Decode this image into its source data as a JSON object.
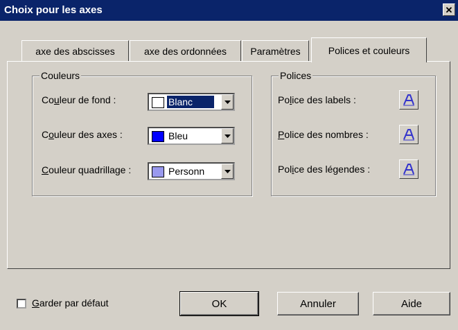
{
  "window": {
    "title": "Choix pour les axes",
    "close_label": "✕"
  },
  "tabs": [
    {
      "label": "axe des abscisses"
    },
    {
      "label": "axe des ordonnées"
    },
    {
      "label": "Paramètres"
    },
    {
      "label": "Polices et couleurs",
      "active": true
    }
  ],
  "couleurs": {
    "legend": "Couleurs",
    "fond": {
      "label_pre": "Co",
      "label_u": "u",
      "label_post": "leur de fond :",
      "value": "Blanc",
      "color": "#ffffff"
    },
    "axes": {
      "label_pre": "C",
      "label_u": "o",
      "label_post": "uleur des axes :",
      "value": "Bleu",
      "color": "#0000ff"
    },
    "quadrillage": {
      "label_pre": "",
      "label_u": "C",
      "label_post": "ouleur quadrillage :",
      "value": "Personn",
      "color": "#9999ee"
    }
  },
  "polices": {
    "legend": "Polices",
    "labels": {
      "label_pre": "Po",
      "label_u": "l",
      "label_post": "ice des labels :"
    },
    "nombres": {
      "label_pre": "",
      "label_u": "P",
      "label_post": "olice des nombres :"
    },
    "legendes": {
      "label_pre": "Pol",
      "label_u": "i",
      "label_post": "ce des légendes :"
    }
  },
  "footer": {
    "default_label_u": "G",
    "default_label_post": "arder par défaut",
    "ok": "OK",
    "annuler": "Annuler",
    "aide": "Aide"
  },
  "icons": {
    "font": "font-icon",
    "dropdown": "chevron-down-icon",
    "close": "close-icon"
  }
}
